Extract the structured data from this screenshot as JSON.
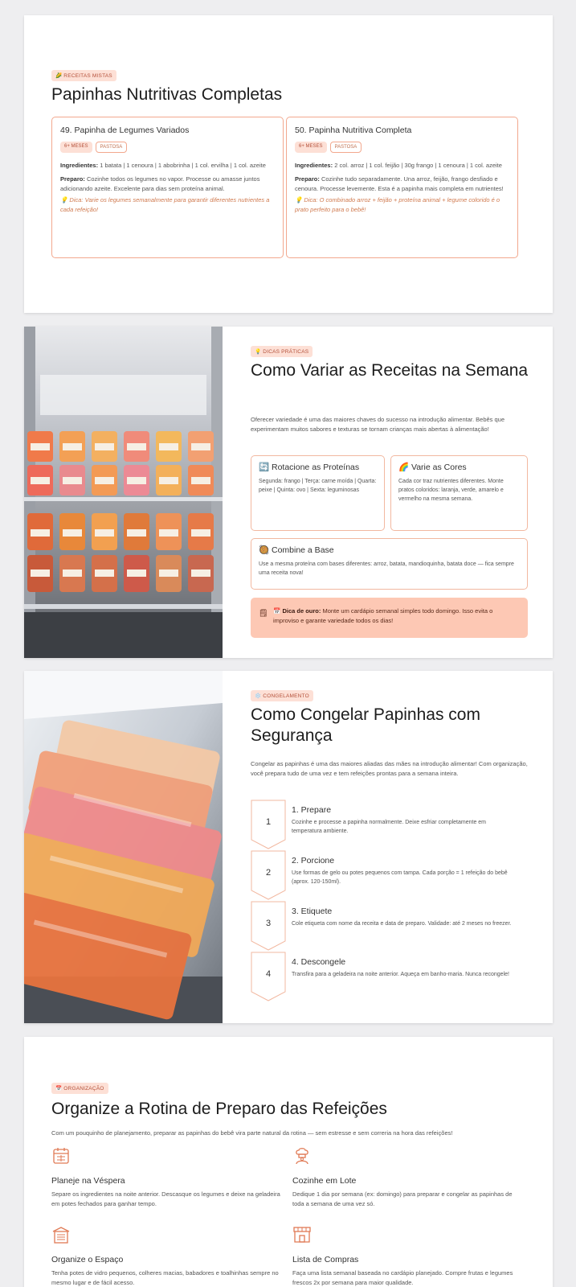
{
  "s1": {
    "tag": "🌽 Receitas Mistas",
    "title": "Papinhas Nutritivas Completas",
    "recipes": [
      {
        "title": "49. Papinha de Legumes Variados",
        "chip_age": "6+ meses",
        "chip_texture": "Pastosa",
        "ingredients_label": "Ingredientes:",
        "ingredients": "1 batata | 1 cenoura | 1 abobrinha | 1 col. ervilha | 1 col. azeite",
        "prep_label": "Preparo:",
        "prep": "Cozinhe todos os legumes no vapor. Processe ou amasse juntos adicionando azeite. Excelente para dias sem proteína animal.",
        "tip": "💡 Dica: Varie os legumes semanalmente para garantir diferentes nutrientes a cada refeição!"
      },
      {
        "title": "50. Papinha Nutritiva Completa",
        "chip_age": "6+ meses",
        "chip_texture": "Pastosa",
        "ingredients_label": "Ingredientes:",
        "ingredients": "2 col. arroz | 1 col. feijão | 30g frango | 1 cenoura | 1 col. azeite",
        "prep_label": "Preparo:",
        "prep": "Cozinhe tudo separadamente. Una arroz, feijão, frango desfiado e cenoura. Processe levemente. Esta é a papinha mais completa em nutrientes!",
        "tip": "💡 Dica: O combinado arroz + feijão + proteína animal + legume colorido é o prato perfeito para o bebê!"
      }
    ]
  },
  "s2": {
    "tag": "💡 Dicas Práticas",
    "title": "Como Variar as Receitas na Semana",
    "intro": "Oferecer variedade é uma das maiores chaves do sucesso na introdução alimentar. Bebês que experimentam muitos sabores e texturas se tornam crianças mais abertas à alimentação!",
    "box1_title": "🔄 Rotacione as Proteínas",
    "box1_text": "Segunda: frango | Terça: carne moída | Quarta: peixe | Quinta: ovo | Sexta: leguminosas",
    "box2_title": "🌈 Varie as Cores",
    "box2_text": "Cada cor traz nutrientes diferentes. Monte pratos coloridos: laranja, verde, amarelo e vermelho na mesma semana.",
    "box3_title": "🥘 Combine a Base",
    "box3_text": "Use a mesma proteína com bases diferentes: arroz, batata, mandioquinha, batata doce — fica sempre uma receita nova!",
    "gold_icon": "📅",
    "gold_label": "Dica de ouro:",
    "gold_text": "Monte um cardápio semanal simples todo domingo. Isso evita o improviso e garante variedade todos os dias!"
  },
  "s3": {
    "tag": "❄️ Congelamento",
    "title": "Como Congelar Papinhas com Segurança",
    "intro": "Congelar as papinhas é uma das maiores aliadas das mães na introdução alimentar! Com organização, você prepara tudo de uma vez e tem refeições prontas para a semana inteira.",
    "steps": [
      {
        "num": "1",
        "title": "1. Prepare",
        "text": "Cozinhe e processe a papinha normalmente. Deixe esfriar completamente em temperatura ambiente."
      },
      {
        "num": "2",
        "title": "2. Porcione",
        "text": "Use formas de gelo ou potes pequenos com tampa. Cada porção = 1 refeição do bebê (aprox. 120-150ml)."
      },
      {
        "num": "3",
        "title": "3. Etiquete",
        "text": "Cole etiqueta com nome da receita e data de preparo. Validade: até 2 meses no freezer."
      },
      {
        "num": "4",
        "title": "4. Descongele",
        "text": "Transfira para a geladeira na noite anterior. Aqueça em banho-maria. Nunca recongele!"
      }
    ]
  },
  "s4": {
    "tag": "📅 Organização",
    "title": "Organize a Rotina de Preparo das Refeições",
    "intro": "Com um pouquinho de planejamento, preparar as papinhas do bebê vira parte natural da rotina — sem estresse e sem correria na hora das refeições!",
    "items": [
      {
        "title": "Planeje na Véspera",
        "text": "Separe os ingredientes na noite anterior. Descasque os legumes e deixe na geladeira em potes fechados para ganhar tempo.",
        "icon": "calendar-icon"
      },
      {
        "title": "Cozinhe em Lote",
        "text": "Dedique 1 dia por semana (ex: domingo) para preparar e congelar as papinhas de toda a semana de uma vez só.",
        "icon": "chef-icon"
      },
      {
        "title": "Organize o Espaço",
        "text": "Tenha potes de vidro pequenos, colheres macias, babadores e toalhinhas sempre no mesmo lugar e de fácil acesso.",
        "icon": "cabinet-icon"
      },
      {
        "title": "Lista de Compras",
        "text": "Faça uma lista semanal baseada no cardápio planejado. Compre frutas e legumes frescos 2x por semana para maior qualidade.",
        "icon": "store-icon"
      }
    ]
  },
  "colors": {
    "accent": "#f2a88e",
    "accent_fill": "#fde0d6",
    "gold_bg": "#fdc8b4",
    "icon": "#e07a55"
  }
}
